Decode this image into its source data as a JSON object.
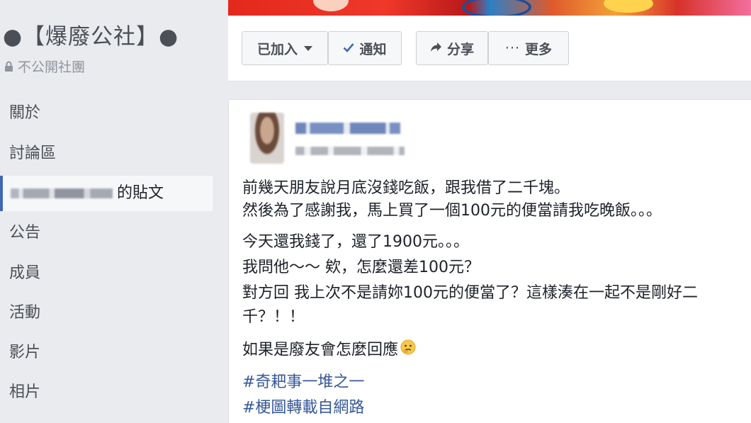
{
  "sidebar": {
    "group_name": "●【爆廢公社】●",
    "privacy": "不公開社團",
    "items": [
      {
        "label": "關於"
      },
      {
        "label": "討論區"
      },
      {
        "label": "的貼文"
      },
      {
        "label": "公告"
      },
      {
        "label": "成員"
      },
      {
        "label": "活動"
      },
      {
        "label": "影片"
      },
      {
        "label": "相片"
      }
    ]
  },
  "actions": {
    "joined": "已加入",
    "notify": "通知",
    "share": "分享",
    "more": "更多"
  },
  "post": {
    "lines": [
      "前幾天朋友說月底沒錢吃飯，跟我借了二千塊。",
      "然後為了感謝我，馬上買了一個100元的便當請我吃晚飯。。。",
      "今天還我錢了，還了1900元。。。",
      "我問他～～ 欸，怎麼還差100元？",
      "對方回 我上次不是請妳100元的便當了？這樣湊在一起不是剛好二",
      "千？！！",
      "如果是廢友會怎麼回應"
    ],
    "hashtags": [
      "#奇耙事一堆之一",
      "#梗圖轉載自網路"
    ]
  },
  "colors": {
    "page_bg": "#e9ebee",
    "link": "#365899",
    "active_bar": "#4267b2",
    "check": "#4267b2"
  },
  "icons": [
    "lock-icon",
    "caret-down-icon",
    "check-icon",
    "share-arrow-icon",
    "ellipsis-icon",
    "thinking-face-icon"
  ]
}
